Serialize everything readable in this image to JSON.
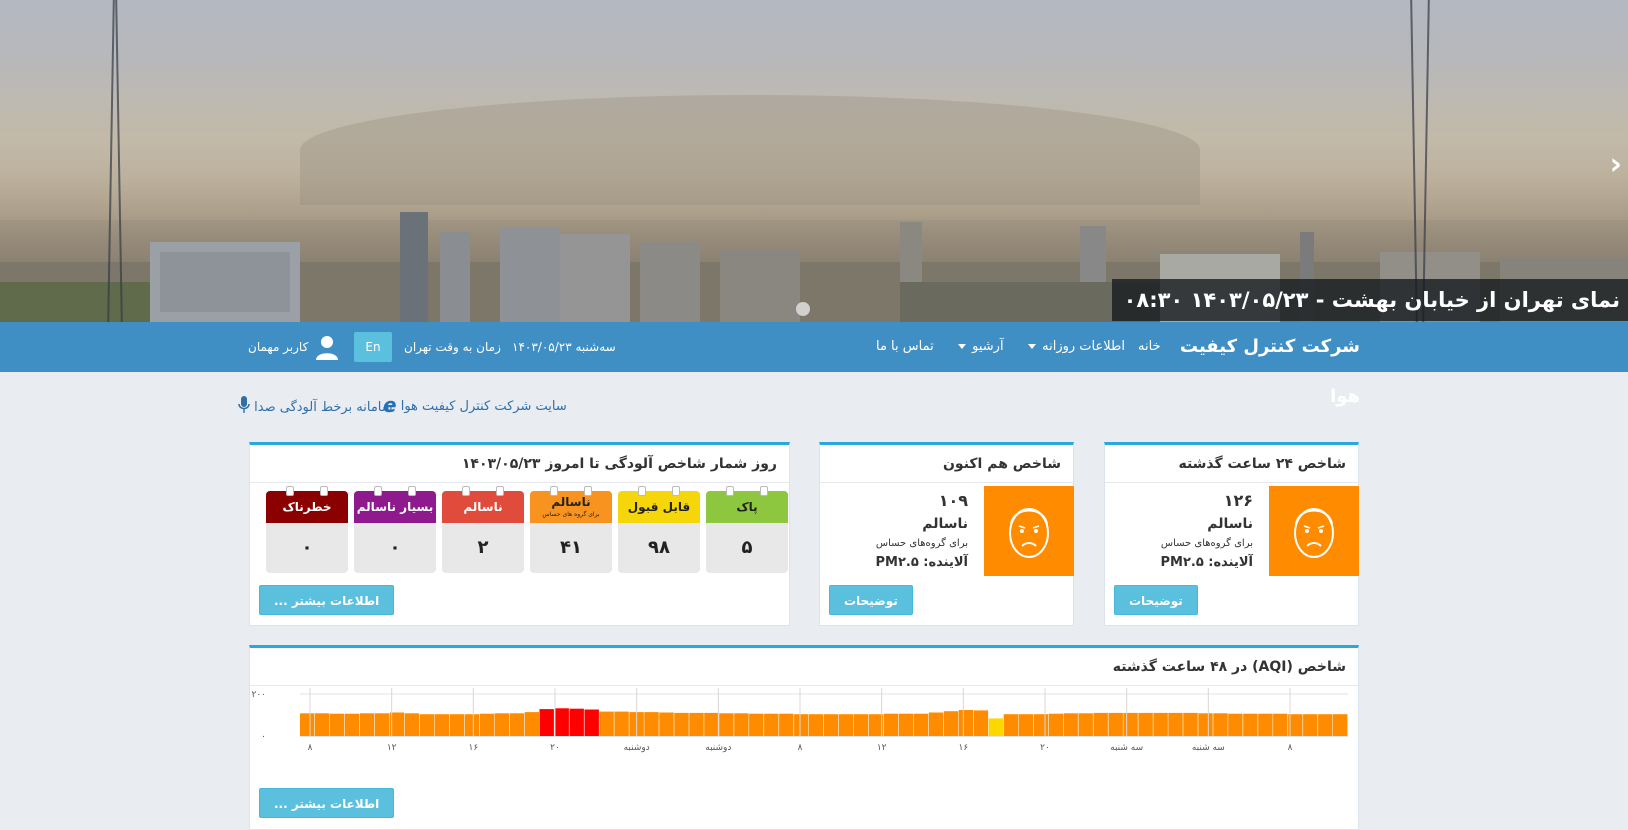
{
  "hero": {
    "caption": "نمای تهران از خیابان بهشت - ۱۴۰۳/۰۵/۲۳ ۰۸:۳۰",
    "next_arrow": "›"
  },
  "navbar": {
    "brand": "شرکت کنترل کیفیت هوا",
    "home": "خانه",
    "daily_info": "اطلاعات روزانه",
    "archive": "آرشیو",
    "contact": "تماس با ما",
    "date": "سه‌شنبه ۱۴۰۳/۰۵/۲۳",
    "time_label": "زمان به وقت تهران",
    "lang_button": "En",
    "user": "کاربر مهمان"
  },
  "links": {
    "company_site": "سایت شرکت کنترل کیفیت هوا",
    "noise_system": "سامانه برخط آلودگی صدا"
  },
  "panel_24h": {
    "title": "شاخص ۲۴ ساعت گذشته",
    "value": "۱۲۶",
    "status": "ناسالم",
    "subtext": "برای گروه‌های حساس",
    "pollutant": "آلاینده: PM۲.۵",
    "button": "توضیحات"
  },
  "panel_now": {
    "title": "شاخص هم اکنون",
    "value": "۱۰۹",
    "status": "ناسالم",
    "subtext": "برای گروه‌های حساس",
    "pollutant": "آلاینده: PM۲.۵",
    "button": "توضیحات"
  },
  "panel_days": {
    "title": "روز شمار شاخص آلودگی تا امروز ۱۴۰۳/۰۵/۲۳",
    "categories": [
      {
        "label": "پاک",
        "value": "۵",
        "color": "#8dc63f",
        "text_color": "#222"
      },
      {
        "label": "قابل قبول",
        "value": "۹۸",
        "color": "#f5d60b",
        "text_color": "#222"
      },
      {
        "label": "ناسالم",
        "sublabel": "برای گروه های حساس",
        "value": "۴۱",
        "color": "#f7931e",
        "text_color": "#222"
      },
      {
        "label": "ناسالم",
        "value": "۲",
        "color": "#e04b3c",
        "text_color": "#fff"
      },
      {
        "label": "بسیار ناسالم",
        "value": "۰",
        "color": "#8e1a8e",
        "text_color": "#fff"
      },
      {
        "label": "خطرناک",
        "value": "۰",
        "color": "#8b0000",
        "text_color": "#fff"
      }
    ],
    "button": "اطلاعات بیشتر ..."
  },
  "panel_chart": {
    "title": "شاخص (AQI) در ۴۸ ساعت گذشته",
    "button": "اطلاعات بیشتر ..."
  },
  "chart_data": {
    "type": "bar",
    "title": "شاخص (AQI) در ۴۸ ساعت گذشته",
    "ylim": [
      0,
      200
    ],
    "yticks": [
      "۰",
      "۲۰۰"
    ],
    "values": [
      108,
      108,
      106,
      106,
      108,
      108,
      112,
      108,
      104,
      104,
      104,
      104,
      106,
      108,
      108,
      114,
      128,
      132,
      130,
      126,
      116,
      116,
      114,
      114,
      112,
      110,
      110,
      110,
      108,
      108,
      106,
      106,
      106,
      104,
      104,
      104,
      104,
      104,
      104,
      106,
      106,
      106,
      112,
      118,
      124,
      122,
      84,
      104,
      104,
      104,
      106,
      108,
      108,
      110,
      110,
      110,
      110,
      110,
      110,
      110,
      108,
      108,
      106,
      106,
      106,
      106,
      104,
      104,
      104,
      104
    ],
    "colors": {
      "unhealthy_sensitive": "#ff8c00",
      "unhealthy": "#ff0000",
      "moderate": "#ffd700"
    },
    "xticks": [
      "۸",
      "۱۲",
      "۱۶",
      "۲۰",
      "دوشنبه",
      "دوشنبه",
      "۸",
      "۱۲",
      "۱۶",
      "۲۰",
      "سه شنبه",
      "سه شنبه",
      "۸"
    ]
  }
}
